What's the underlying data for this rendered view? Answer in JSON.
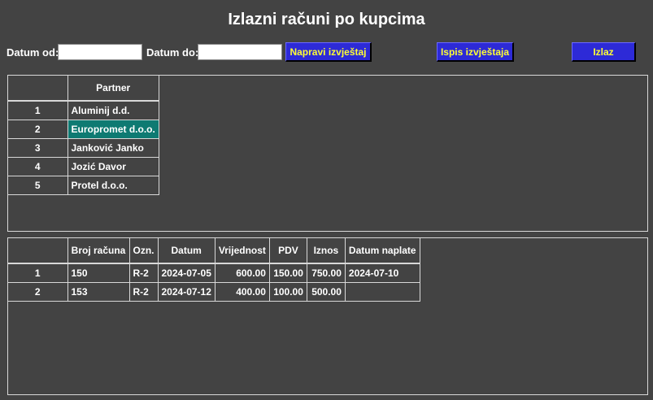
{
  "window": {
    "title": "Izlazni računi po kupcima"
  },
  "toolbar": {
    "date_from_label": "Datum od:",
    "date_from_value": "",
    "date_to_label": "Datum do:",
    "date_to_value": "",
    "make_report_label": "Napravi izvještaj",
    "print_report_label": "Ispis izvještaja",
    "exit_label": "Izlaz"
  },
  "colors": {
    "background": "#434343",
    "button_bg": "#2d2ad7",
    "button_text": "#ffff33",
    "selection": "#0e7a72",
    "grid_line": "#d8d8d8"
  },
  "partners": {
    "columns": [
      "",
      "Partner"
    ],
    "selected_row": 1,
    "rows": [
      {
        "idx": "1",
        "partner": "Aluminij d.d."
      },
      {
        "idx": "2",
        "partner": "Europromet d.o.o."
      },
      {
        "idx": "3",
        "partner": "Janković Janko"
      },
      {
        "idx": "4",
        "partner": "Jozić Davor"
      },
      {
        "idx": "5",
        "partner": "Protel d.o.o."
      }
    ]
  },
  "invoices": {
    "columns": [
      "",
      "Broj računa",
      "Ozn.",
      "Datum",
      "Vrijednost",
      "PDV",
      "Iznos",
      "Datum naplate"
    ],
    "rows": [
      {
        "idx": "1",
        "broj": "150",
        "ozn": "R-2",
        "datum": "2024-07-05",
        "vrijednost": "600.00",
        "pdv": "150.00",
        "iznos": "750.00",
        "datum_naplate": "2024-07-10"
      },
      {
        "idx": "2",
        "broj": "153",
        "ozn": "R-2",
        "datum": "2024-07-12",
        "vrijednost": "400.00",
        "pdv": "100.00",
        "iznos": "500.00",
        "datum_naplate": ""
      }
    ]
  }
}
